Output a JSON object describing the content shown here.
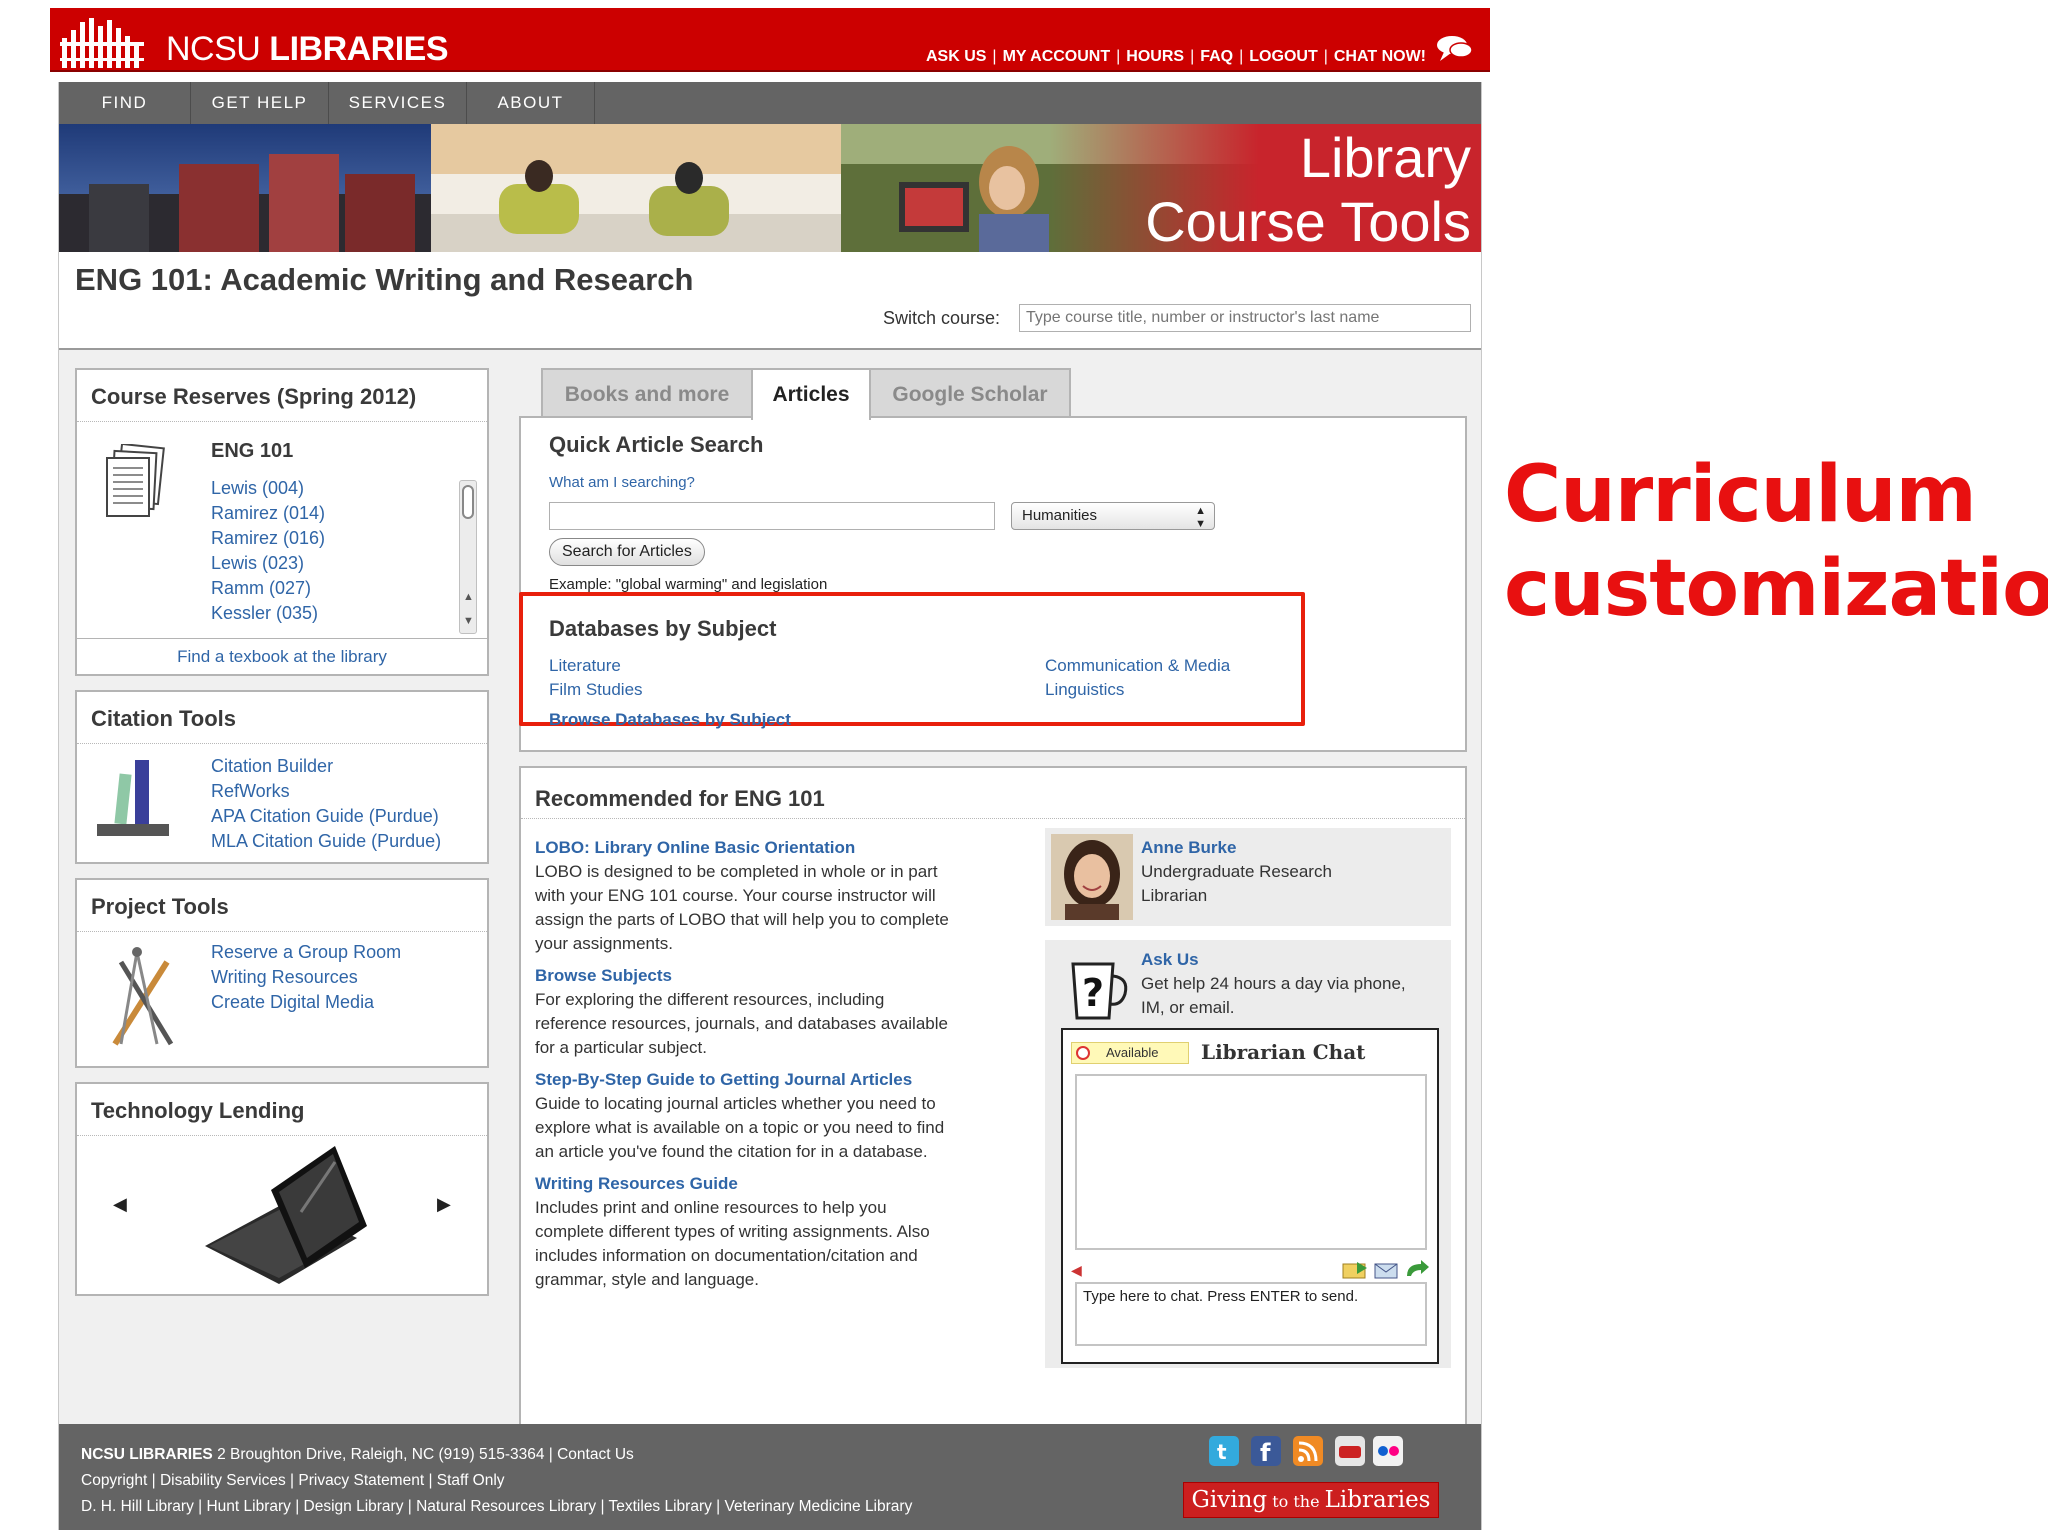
{
  "header": {
    "logo_prefix": "NCSU",
    "logo_main": "LIBRARIES",
    "utility_links": [
      "ASK US",
      "MY ACCOUNT",
      "HOURS",
      "FAQ",
      "LOGOUT",
      "CHAT NOW!"
    ]
  },
  "nav": [
    "FIND",
    "GET HELP",
    "SERVICES",
    "ABOUT"
  ],
  "banner": {
    "title_line1": "Library",
    "title_line2": "Course Tools"
  },
  "course": {
    "title": "ENG 101: Academic Writing and Research",
    "switch_label": "Switch course:",
    "switch_placeholder": "Type course title, number or instructor's last name"
  },
  "reserves": {
    "heading": "Course Reserves (Spring 2012)",
    "course": "ENG 101",
    "sections": [
      "Lewis (004)",
      "Ramirez (014)",
      "Ramirez (016)",
      "Lewis (023)",
      "Ramm (027)",
      "Kessler (035)"
    ],
    "footer_link": "Find a texbook at the library"
  },
  "citation": {
    "heading": "Citation Tools",
    "links": [
      "Citation Builder",
      "RefWorks",
      "APA Citation Guide (Purdue)",
      "MLA Citation Guide (Purdue)"
    ]
  },
  "project": {
    "heading": "Project Tools",
    "links": [
      "Reserve a Group Room",
      "Writing Resources",
      "Create Digital Media"
    ]
  },
  "lending": {
    "heading": "Technology Lending"
  },
  "tabs": [
    "Books and more",
    "Articles",
    "Google Scholar"
  ],
  "active_tab": "Articles",
  "quick_search": {
    "heading": "Quick Article Search",
    "help_link": "What am I searching?",
    "input_value": "",
    "subject_selected": "Humanities",
    "button": "Search for Articles",
    "example": "Example: \"global warming\" and legislation"
  },
  "databases": {
    "heading": "Databases by Subject",
    "col1": [
      "Literature",
      "Film Studies"
    ],
    "col2": [
      "Communication & Media",
      "Linguistics"
    ],
    "browse": "Browse Databases by Subject",
    "highlight_color": "#e8200c"
  },
  "recommended": {
    "heading": "Recommended for ENG 101",
    "items": [
      {
        "title": "LOBO: Library Online Basic Orientation",
        "desc_lines": [
          "LOBO is designed to be completed in whole or in part",
          "with your ENG 101 course. Your course instructor will",
          "assign the parts of LOBO that will help you to complete",
          "your assignments."
        ]
      },
      {
        "title": "Browse Subjects",
        "desc_lines": [
          "For exploring the different resources, including",
          "reference resources, journals, and databases available",
          "for a particular subject."
        ]
      },
      {
        "title": "Step-By-Step Guide to Getting Journal Articles",
        "desc_lines": [
          "Guide to locating journal articles whether you need to",
          "explore what is available on a topic or you need to find",
          "an article you've found the citation for in a database."
        ]
      },
      {
        "title": "Writing Resources Guide",
        "desc_lines": [
          "Includes print and online resources to help you",
          "complete different types of writing assignments. Also",
          "includes information on documentation/citation and",
          "grammar, style and language."
        ]
      }
    ]
  },
  "librarian": {
    "name": "Anne Burke",
    "role_line1": "Undergraduate Research",
    "role_line2": "Librarian"
  },
  "ask_us": {
    "title": "Ask Us",
    "line1": "Get help 24 hours a day via phone,",
    "line2": "IM, or email."
  },
  "chat": {
    "status": "Available",
    "title": "Librarian Chat",
    "input_placeholder": "Type here to chat. Press ENTER to send."
  },
  "footer": {
    "org": "NCSU LIBRARIES",
    "line1_rest": " 2 Broughton Drive, Raleigh, NC (919) 515-3364 | Contact Us",
    "line2": "Copyright | Disability Services | Privacy Statement | Staff Only",
    "line3": "D. H. Hill Library | Hunt Library | Design Library | Natural Resources Library | Textiles Library | Veterinary Medicine Library",
    "giving_pre": "Giving",
    "giving_mid": " to the ",
    "giving_post": "Libraries",
    "social_icons": [
      "twitter-icon",
      "facebook-icon",
      "rss-icon",
      "youtube-icon",
      "flickr-icon"
    ]
  },
  "annotation": {
    "line1": "Curriculum",
    "line2": "customization"
  }
}
